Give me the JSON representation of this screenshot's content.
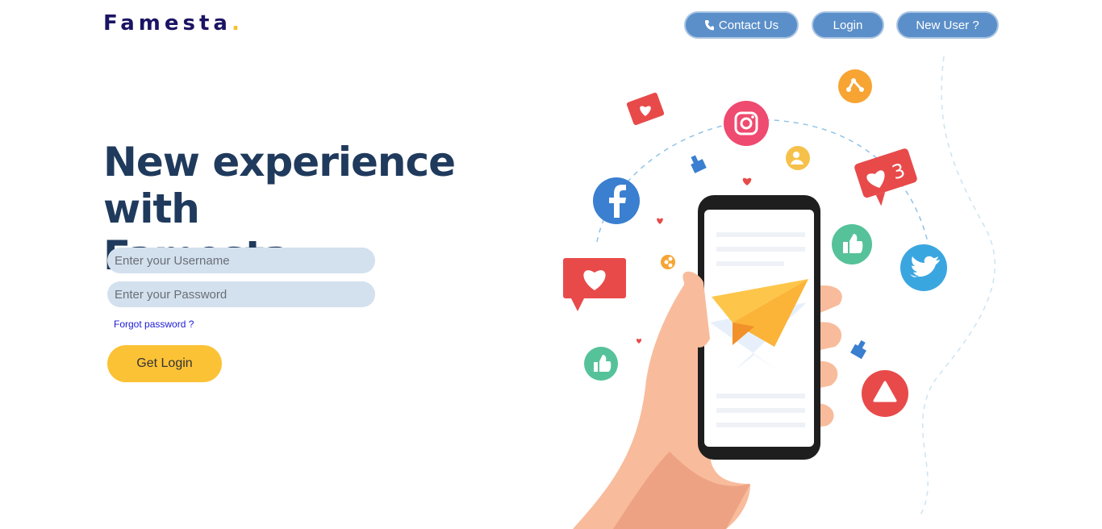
{
  "brand": {
    "name": "Famesta",
    "dot": "."
  },
  "nav": {
    "contact_label": "Contact Us",
    "login_label": "Login",
    "new_user_label": "New User ?"
  },
  "hero": {
    "title_line1": "New experience with",
    "title_line2": "Famesta"
  },
  "form": {
    "username_placeholder": "Enter your Username",
    "password_placeholder": "Enter your Password",
    "forgot_label": "Forgot password ?",
    "submit_label": "Get Login"
  },
  "illustration": {
    "notification_count": "3"
  },
  "colors": {
    "nav_button": "#5b8fc9",
    "title": "#1f3a5c",
    "brand": "#1b1464",
    "accent": "#fbc236",
    "input_bg": "#d3e0ee",
    "link": "#1a1ad6"
  }
}
